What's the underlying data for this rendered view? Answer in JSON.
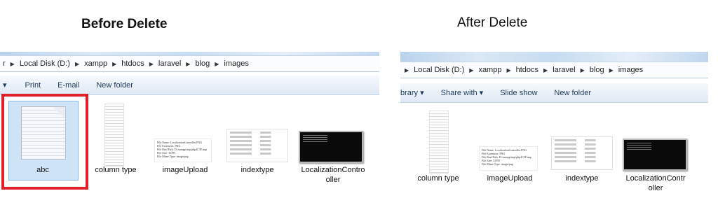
{
  "titles": {
    "before": "Before Delete",
    "after": "After Delete"
  },
  "before": {
    "path": [
      "r",
      "Local Disk (D:)",
      "xampp",
      "htdocs",
      "laravel",
      "blog",
      "images"
    ],
    "toolbar": [
      "▾",
      "Print",
      "E-mail",
      "New folder"
    ],
    "files": [
      "abc",
      "column type",
      "imageUpload",
      "indextype",
      "LocalizationContro",
      "oller"
    ]
  },
  "after": {
    "path": [
      "Local Disk (D:)",
      "xampp",
      "htdocs",
      "laravel",
      "blog",
      "images"
    ],
    "toolbar": [
      "brary ▾",
      "Share with ▾",
      "Slide show",
      "New folder"
    ],
    "files": [
      "column type",
      "imageUpload",
      "indextype",
      "LocalizationContr",
      "oller"
    ]
  },
  "highlight_color": "#e0202a",
  "thumb_text": [
    "File Name: LocalizationController.PNG",
    "File Extension: PNG",
    "File Real Path: D:\\xampp\\tmp\\php4C3F.tmp",
    "File Size: 31595",
    "File Mime Type: image/png"
  ]
}
